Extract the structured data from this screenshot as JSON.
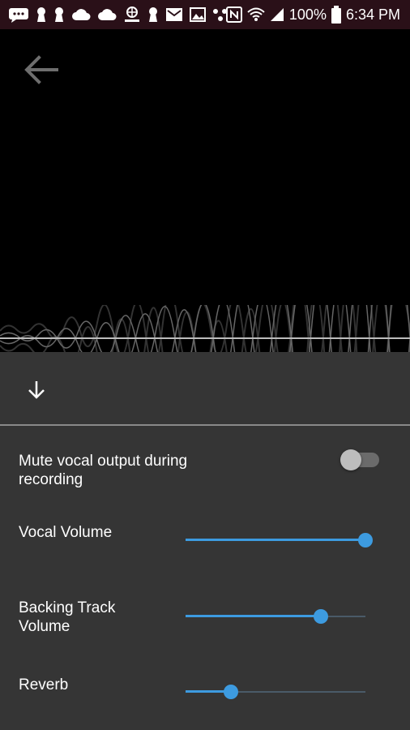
{
  "status_bar": {
    "battery_text": "100%",
    "time": "6:34 PM",
    "left_icons": [
      "chat-icon",
      "keyhole-icon",
      "keyhole-icon",
      "cloud-icon",
      "cloud-icon",
      "directv-icon",
      "keyhole-icon",
      "mail-icon",
      "image-icon",
      "dots-icon"
    ],
    "right_icons": [
      "nfc-icon",
      "wifi-icon",
      "signal-icon",
      "battery-icon"
    ]
  },
  "top": {
    "back_icon": "arrow-back-icon"
  },
  "sheet": {
    "collapse_icon": "arrow-down-icon",
    "mute_label": "Mute vocal output during recording",
    "mute_enabled": false,
    "vocal_volume_label": "Vocal Volume",
    "vocal_volume_level": 1.0,
    "backing_track_label": "Backing Track Volume",
    "backing_track_level": 0.75,
    "reverb_label": "Reverb",
    "reverb_level": 0.25
  },
  "colors": {
    "accent": "#3d9be0",
    "sheet_bg": "#353535",
    "status_bg": "#2a1018"
  }
}
